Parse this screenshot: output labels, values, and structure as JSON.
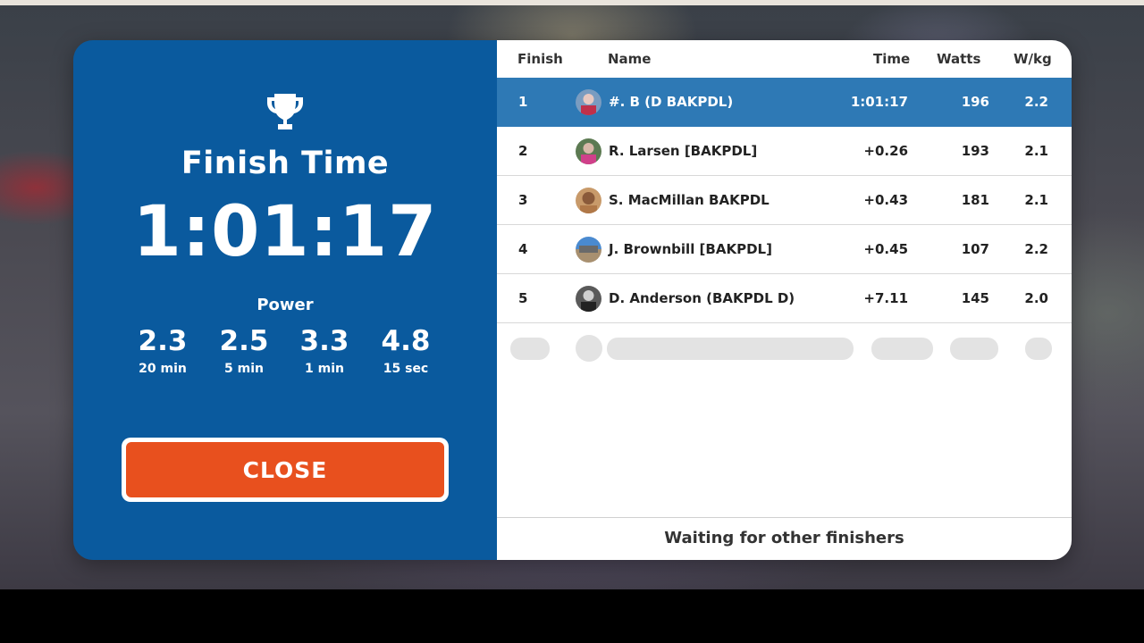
{
  "finish": {
    "title": "Finish Time",
    "time": "1:01:17",
    "power_label": "Power",
    "power": [
      {
        "value": "2.3",
        "duration": "20 min"
      },
      {
        "value": "2.5",
        "duration": "5 min"
      },
      {
        "value": "3.3",
        "duration": "1 min"
      },
      {
        "value": "4.8",
        "duration": "15 sec"
      }
    ],
    "close_label": "CLOSE"
  },
  "results": {
    "headers": {
      "finish": "Finish",
      "name": "Name",
      "time": "Time",
      "watts": "Watts",
      "wkg": "W/kg"
    },
    "rows": [
      {
        "pos": "1",
        "name": "#. B (D BAKPDL)",
        "time": "1:01:17",
        "watts": "196",
        "wkg": "2.2",
        "highlight": true
      },
      {
        "pos": "2",
        "name": "R. Larsen [BAKPDL]",
        "time": "+0.26",
        "watts": "193",
        "wkg": "2.1"
      },
      {
        "pos": "3",
        "name": "S. MacMillan BAKPDL",
        "time": "+0.43",
        "watts": "181",
        "wkg": "2.1"
      },
      {
        "pos": "4",
        "name": "J. Brownbill [BAKPDL]",
        "time": "+0.45",
        "watts": "107",
        "wkg": "2.2"
      },
      {
        "pos": "5",
        "name": "D. Anderson (BAKPDL D)",
        "time": "+7.11",
        "watts": "145",
        "wkg": "2.0"
      }
    ],
    "footer": "Waiting for other finishers"
  },
  "colors": {
    "panel_blue": "#0a5a9e",
    "highlight_row": "#2e79b5",
    "close_orange": "#e8501e"
  }
}
